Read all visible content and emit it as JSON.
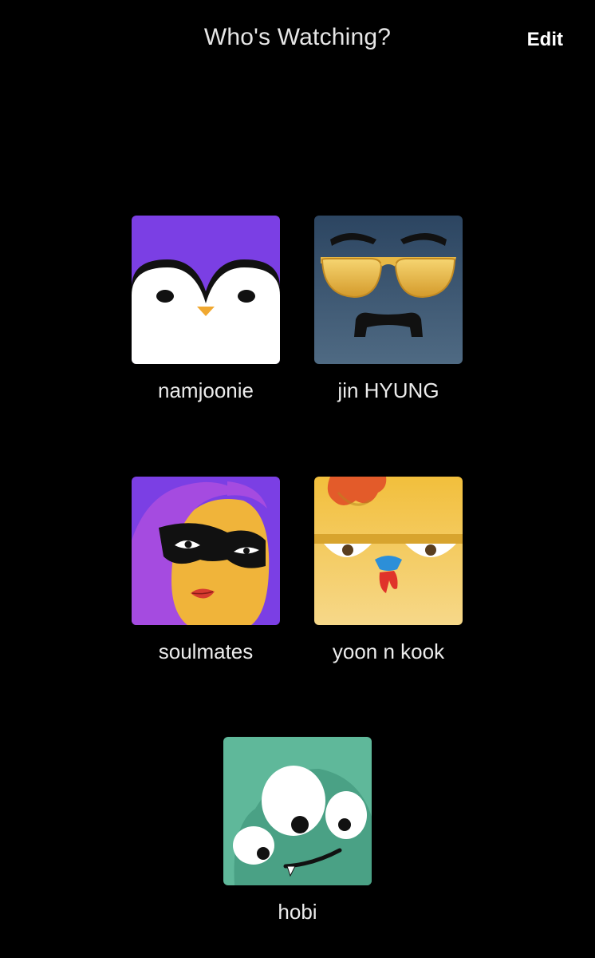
{
  "header": {
    "title": "Who's Watching?",
    "edit_label": "Edit"
  },
  "profiles": [
    {
      "name": "namjoonie",
      "avatar_icon": "penguin-avatar-icon",
      "color": "#7b3fe4"
    },
    {
      "name": "jin HYUNG",
      "avatar_icon": "sunglasses-mustache-avatar-icon",
      "color": "#3b5672"
    },
    {
      "name": "soulmates",
      "avatar_icon": "masked-woman-avatar-icon",
      "color": "#7b3fe4"
    },
    {
      "name": "yoon n kook",
      "avatar_icon": "chicken-avatar-icon",
      "color": "#f2c14e"
    },
    {
      "name": "hobi",
      "avatar_icon": "three-eyed-monster-avatar-icon",
      "color": "#5fb89a"
    }
  ]
}
